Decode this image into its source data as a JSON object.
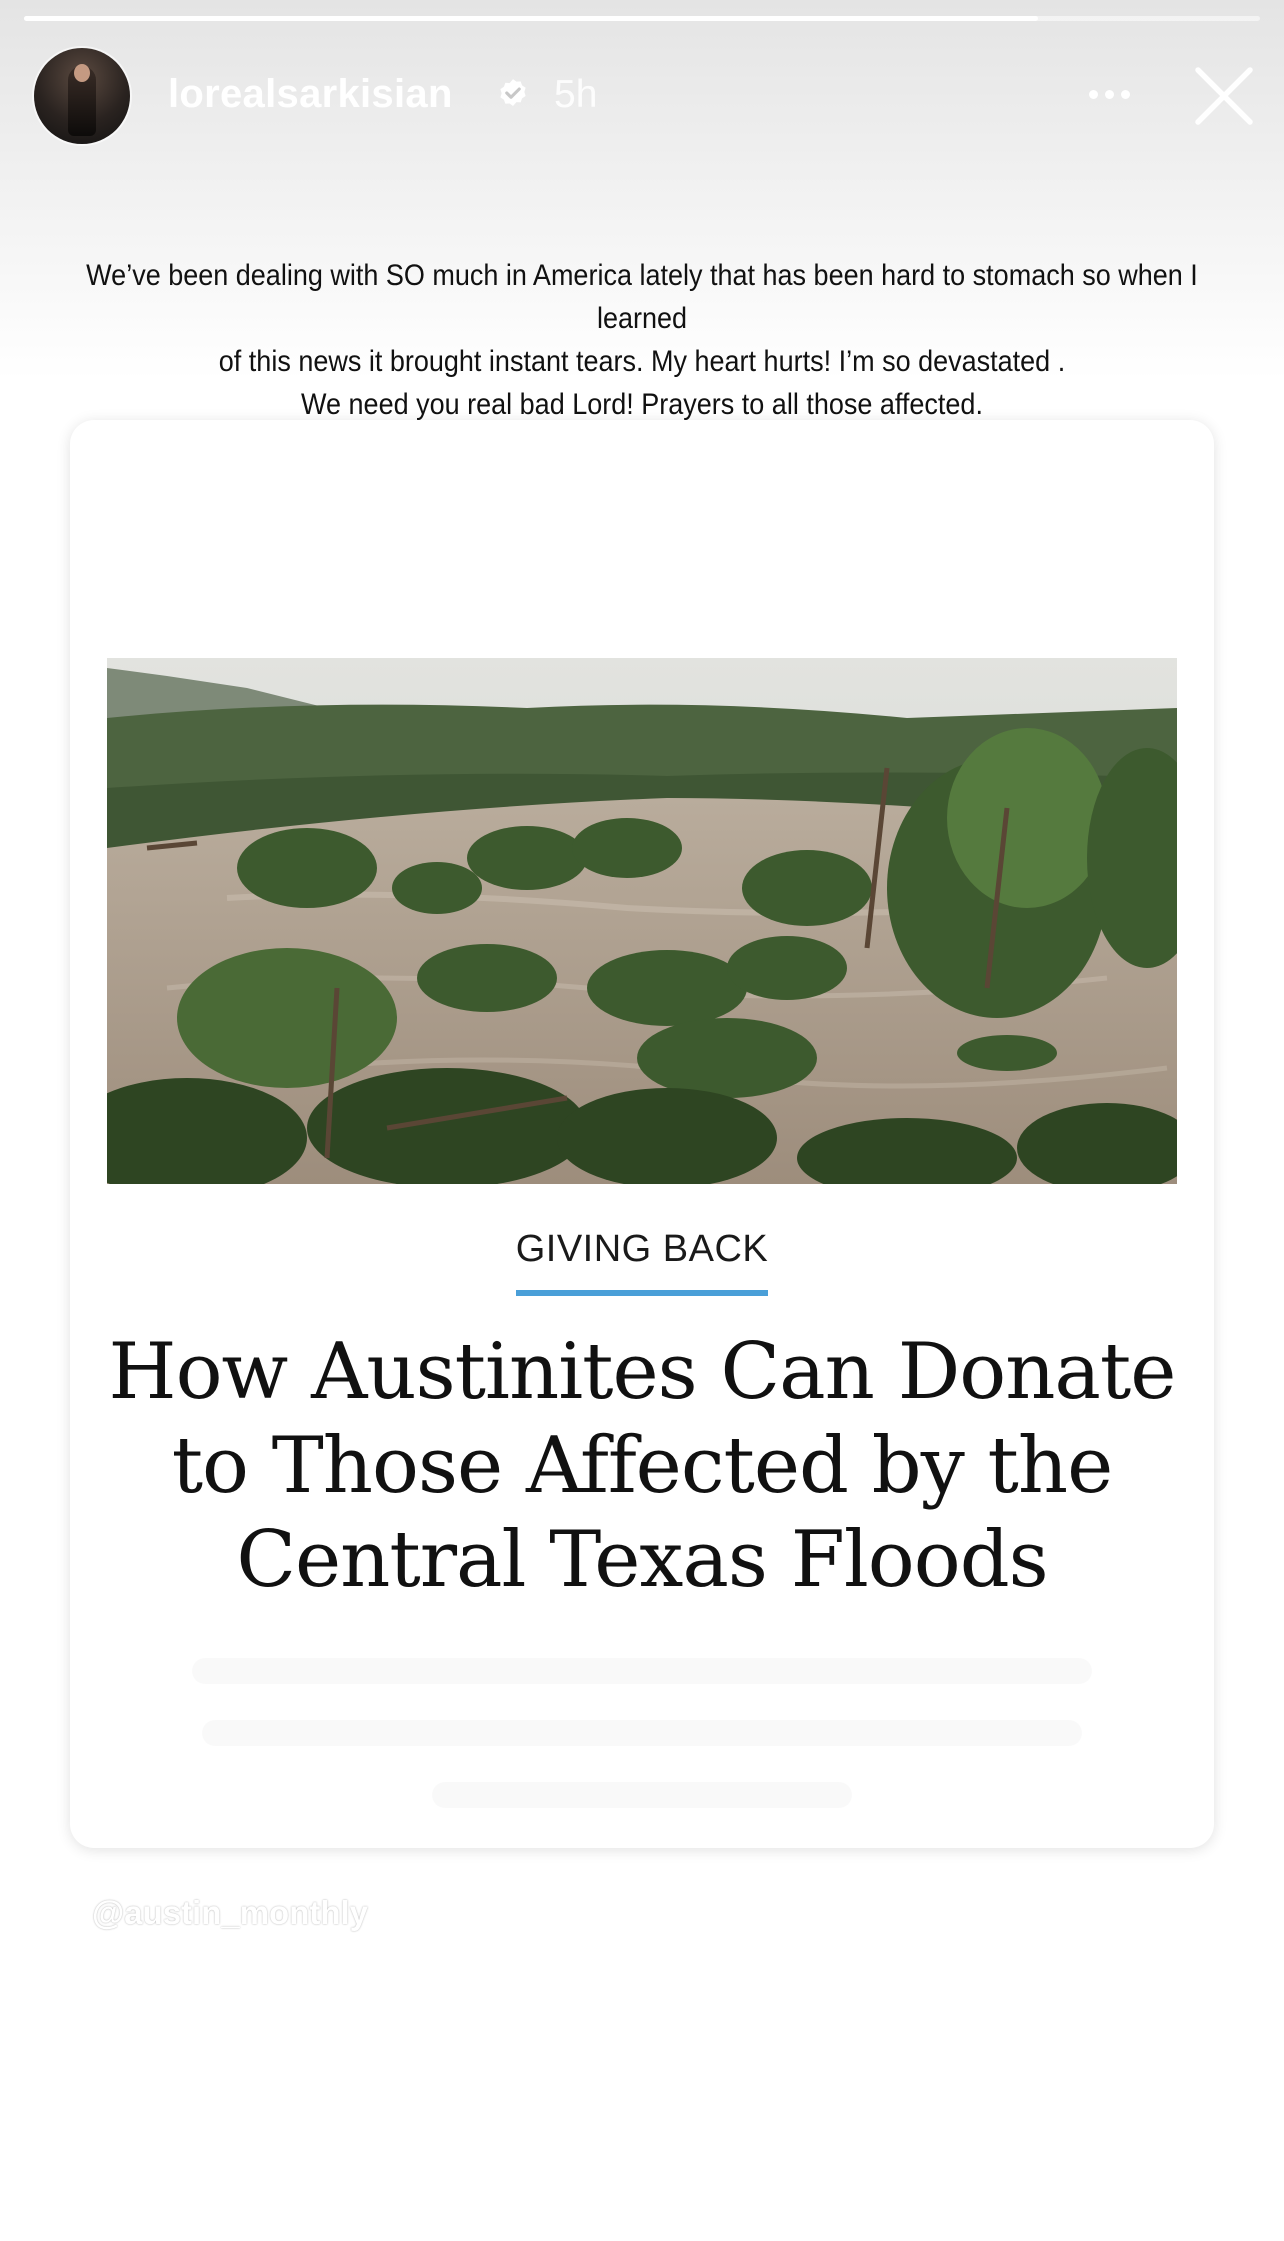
{
  "story": {
    "progress": 0.82,
    "header": {
      "username": "lorealsarkisian",
      "verified": true,
      "time_ago": "5h",
      "more_icon": "more-horizontal-icon",
      "close_icon": "close-icon"
    },
    "caption": "We’ve been dealing with SO much in America lately  that has been hard to stomach so when I learned\nof this news it brought instant tears. My heart hurts! I’m so devastated .\nWe need you real bad Lord!  Prayers to all those affected.",
    "article": {
      "image": "flooded-river-photo",
      "section": "GIVING BACK",
      "section_color": "#4a9fd8",
      "headline": "How Austinites Can Donate\nto Those Affected by the\nCentral Texas Floods"
    },
    "mention": "@austin_monthly"
  }
}
